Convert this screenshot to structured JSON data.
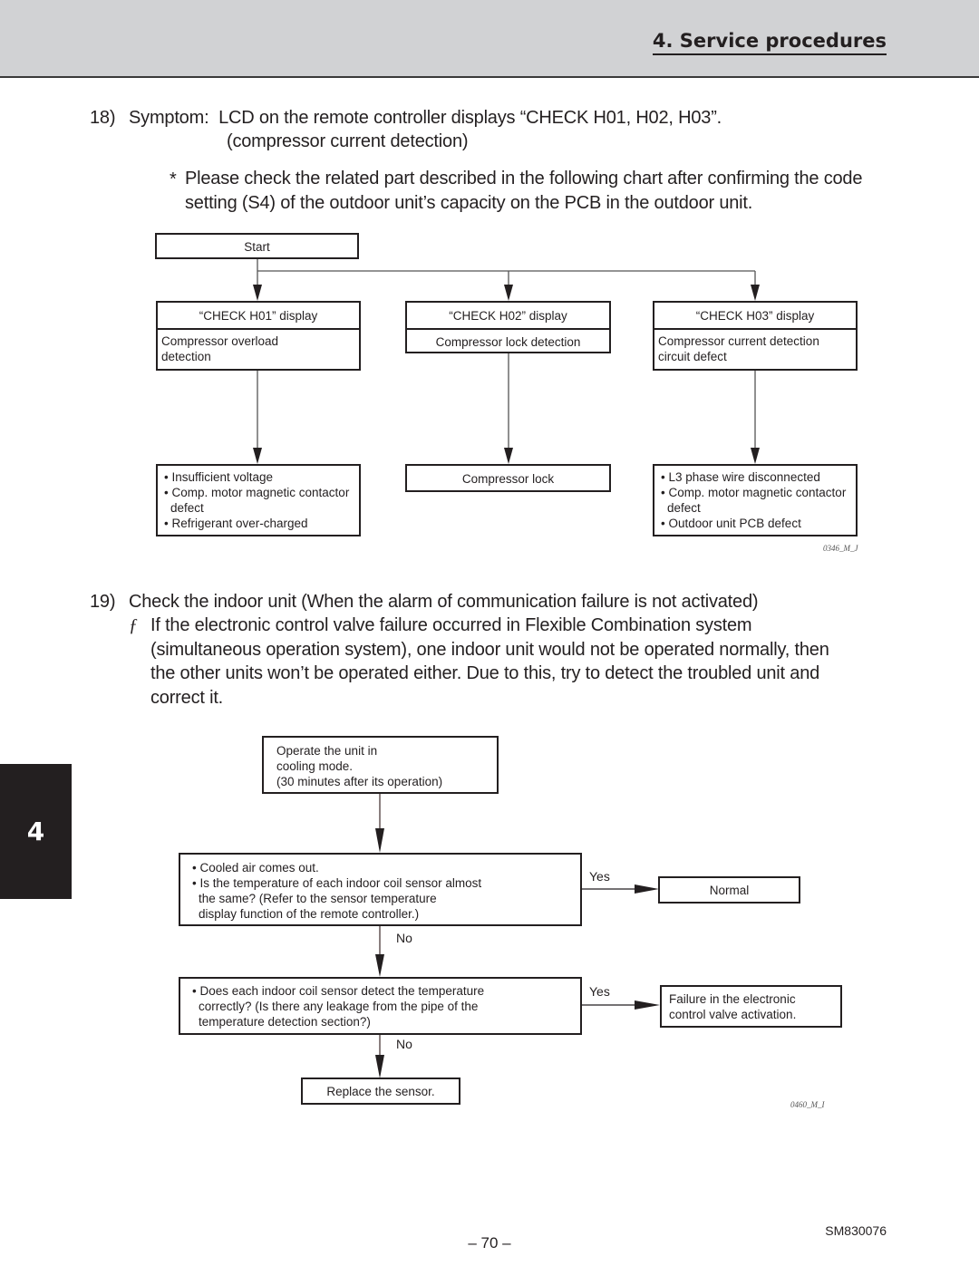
{
  "header": {
    "section_title": "4. Service procedures"
  },
  "chapter_tab": {
    "number": "4"
  },
  "section18": {
    "number": "18)",
    "line1": "Symptom:  LCD on the remote controller displays “CHECK H01, H02, H03”.",
    "line2": "(compressor current detection)",
    "note_marker": "*",
    "note_line1": "Please check the related part described in the following chart after confirming the code",
    "note_line2": "setting (S4) of the outdoor unit’s capacity on the PCB in the outdoor unit.",
    "flow": {
      "start": "Start",
      "columns": [
        {
          "head": "“CHECK H01” display",
          "detail": [
            "Compressor overload",
            "detection"
          ],
          "causes": [
            "Insufficient voltage",
            "Comp. motor magnetic contactor defect",
            "Refrigerant over-charged"
          ]
        },
        {
          "head": "“CHECK H02” display",
          "detail": [
            "Compressor lock detection"
          ],
          "causes": [
            "Compressor lock"
          ]
        },
        {
          "head": "“CHECK H03” display",
          "detail": [
            "Compressor current detection",
            "circuit defect"
          ],
          "causes": [
            "L3 phase wire disconnected",
            "Comp. motor magnetic contactor defect",
            "Outdoor unit PCB defect"
          ]
        }
      ],
      "figure_id": "0346_M_J"
    }
  },
  "section19": {
    "number": "19)",
    "line1": "Check the indoor unit (When the alarm of communication failure is not activated)",
    "bullet_marker": "ƒ",
    "body_lines": [
      "If the electronic control valve failure occurred in Flexible Combination system",
      "(simultaneous operation system), one indoor unit would not be operated normally, then",
      "the other units won’t be operated either. Due to this, try to detect the troubled unit and",
      "correct it."
    ],
    "flow": {
      "step1": [
        "Operate the unit in",
        "cooling mode.",
        "(30 minutes after its operation)"
      ],
      "check1": {
        "bullets": [
          "Cooled air comes out.",
          "Is the temperature of each indoor coil sensor almost the same? (Refer to the sensor temperature display function of the remote controller.)"
        ],
        "bullet2_lines": [
          "Is the temperature of each indoor coil sensor almost",
          "the same? (Refer to the sensor temperature",
          "display function of the remote controller.)"
        ],
        "yes_label": "Yes",
        "no_label": "No",
        "yes_result": "Normal"
      },
      "check2": {
        "lines": [
          "Does each indoor coil sensor detect the temperature",
          "correctly? (Is there any leakage from the pipe of the",
          "temperature detection section?)"
        ],
        "yes_label": "Yes",
        "no_label": "No",
        "yes_result": [
          "Failure in the electronic",
          "control valve activation."
        ]
      },
      "final": "Replace the sensor.",
      "figure_id": "0460_M_I"
    }
  },
  "footer": {
    "page": "– 70 –",
    "doc_code": "SM830076"
  }
}
